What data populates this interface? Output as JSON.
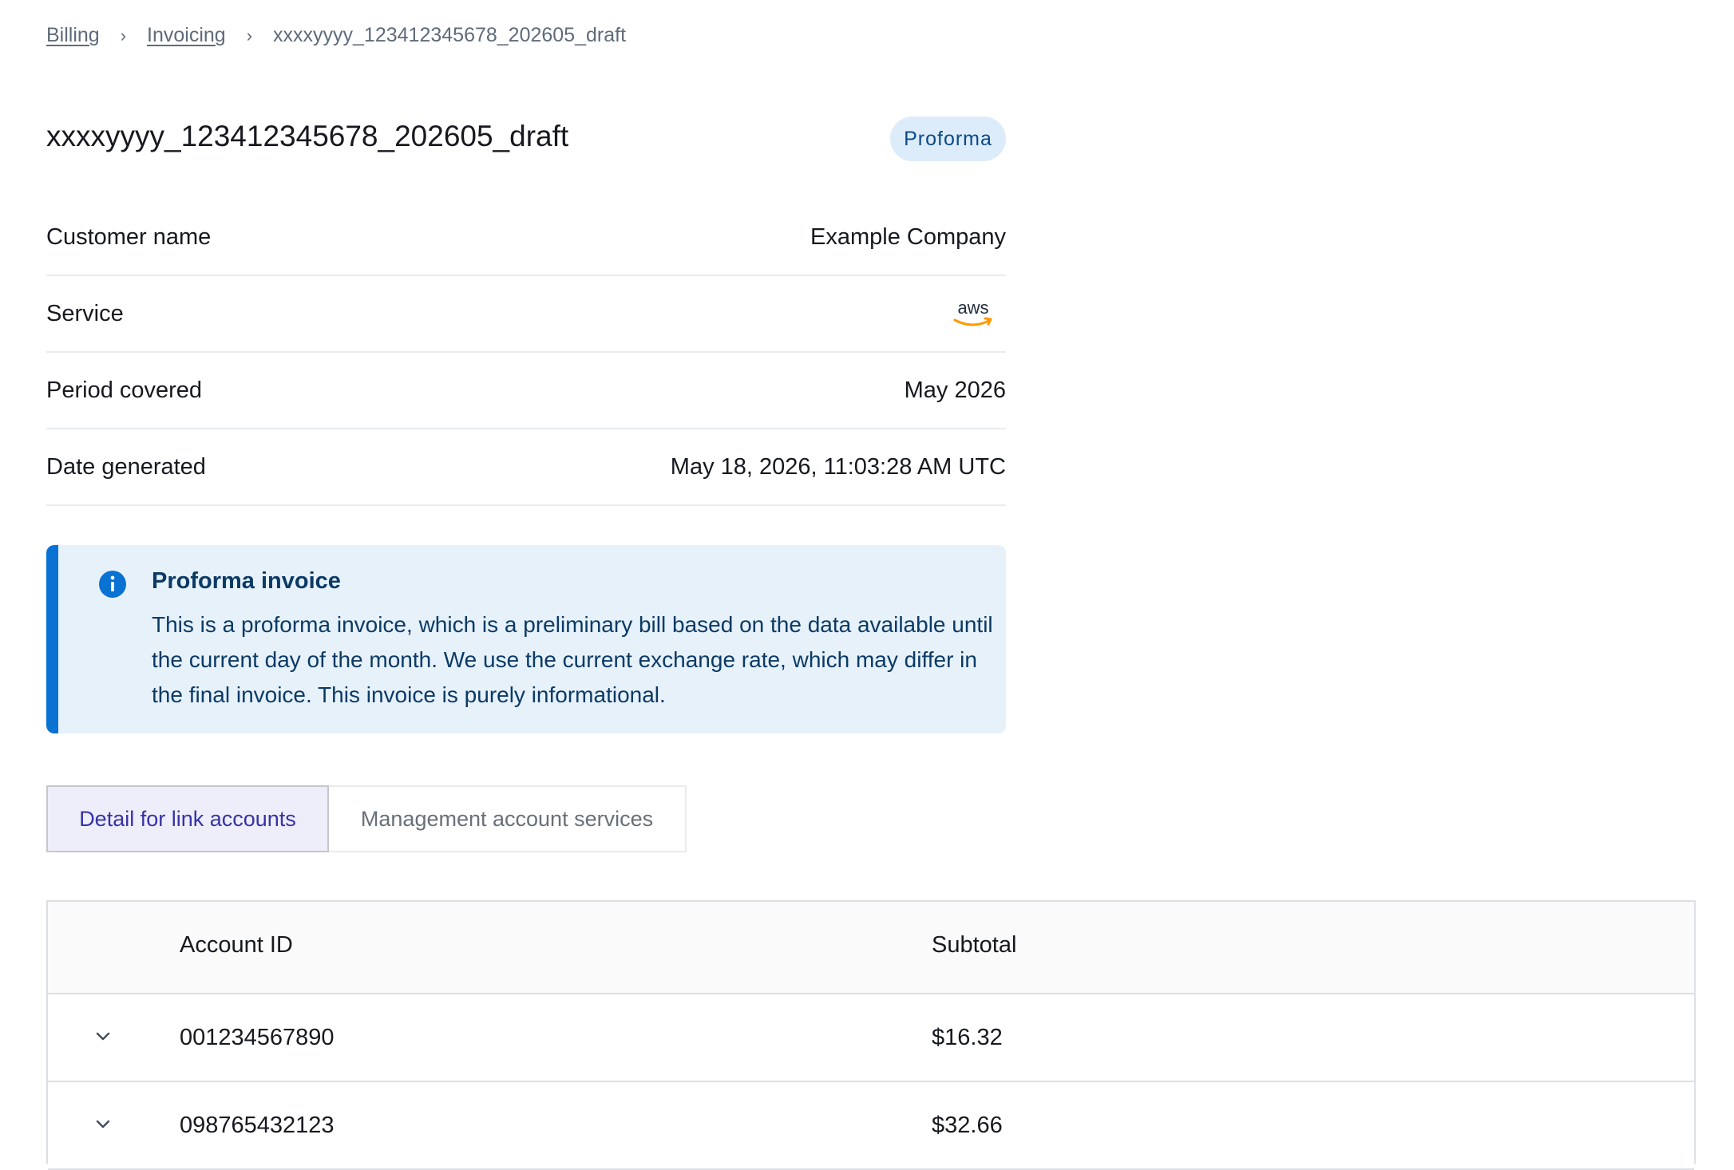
{
  "breadcrumb": {
    "items": [
      "Billing",
      "Invoicing"
    ],
    "current": "xxxxyyyy_123412345678_202605_draft"
  },
  "header": {
    "title": "xxxxyyyy_123412345678_202605_draft",
    "badge": "Proforma"
  },
  "details": {
    "customer_name_label": "Customer name",
    "customer_name_value": "Example Company",
    "service_label": "Service",
    "service_value_icon": "aws-logo-icon",
    "period_label": "Period covered",
    "period_value": "May 2026",
    "date_label": "Date generated",
    "date_value": "May 18, 2026, 11:03:28 AM UTC"
  },
  "alert": {
    "icon": "info-icon",
    "title": "Proforma invoice",
    "body": "This is a proforma invoice, which is a preliminary bill based on the data available until the current day of the month. We use the current exchange rate, which may differ in the final invoice. This invoice is purely informational."
  },
  "tabs": [
    {
      "label": "Detail for link accounts",
      "active": true
    },
    {
      "label": "Management account services",
      "active": false
    }
  ],
  "table": {
    "columns": [
      "Account ID",
      "Subtotal"
    ],
    "rows": [
      {
        "account_id": "001234567890",
        "subtotal": "$16.32"
      },
      {
        "account_id": "098765432123",
        "subtotal": "$32.66"
      }
    ]
  },
  "colors": {
    "accent_blue": "#0972d3",
    "alert_bg": "#e6f1fa",
    "badge_bg": "#dcecfa",
    "active_tab_text": "#3633a6",
    "aws_orange": "#ff9900"
  }
}
